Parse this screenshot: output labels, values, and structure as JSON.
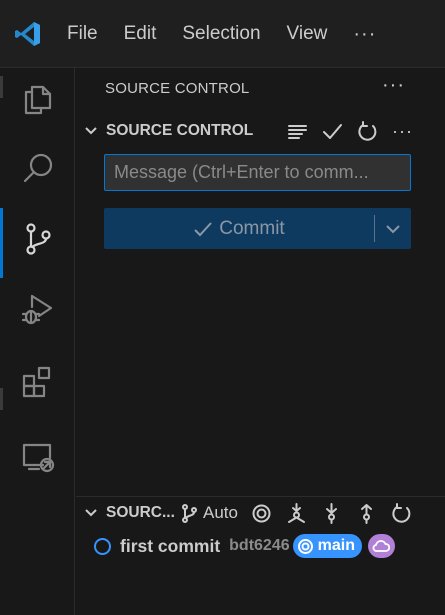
{
  "titlebar": {
    "menu": [
      "File",
      "Edit",
      "Selection",
      "View"
    ],
    "more": "···",
    "back": "‹"
  },
  "activitybar": {
    "items": [
      {
        "name": "explorer",
        "icon": "files-icon"
      },
      {
        "name": "search",
        "icon": "search-icon"
      },
      {
        "name": "source-control",
        "icon": "source-control-icon",
        "active": true
      },
      {
        "name": "run-and-debug",
        "icon": "debug-icon"
      },
      {
        "name": "extensions",
        "icon": "extensions-icon"
      },
      {
        "name": "remote-explorer",
        "icon": "remote-explorer-icon"
      }
    ]
  },
  "sidebar": {
    "title": "SOURCE CONTROL",
    "more": "···",
    "repo_section": {
      "label": "SOURCE CONTROL",
      "actions": [
        "view-as-tree-icon",
        "check-icon",
        "refresh-icon",
        "more-icon"
      ],
      "more": "···"
    },
    "message_input": {
      "placeholder": "Message (Ctrl+Enter to comm...",
      "value": ""
    },
    "commit_button": {
      "label": "Commit"
    },
    "graph_section": {
      "label": "SOURC...",
      "auto_label": "Auto",
      "actions": [
        "go-to-current-icon",
        "fetch-icon",
        "pull-icon",
        "push-icon",
        "refresh-icon"
      ]
    },
    "graph_rows": [
      {
        "message": "first commit",
        "author": "bdt6246",
        "branch": "main",
        "remote_icon": "cloud-icon"
      }
    ]
  },
  "colors": {
    "accent": "#0078d4",
    "branch_badge": "#3794ff",
    "remote_badge": "#b180d7",
    "commit_button_bg": "#0e3a60"
  }
}
